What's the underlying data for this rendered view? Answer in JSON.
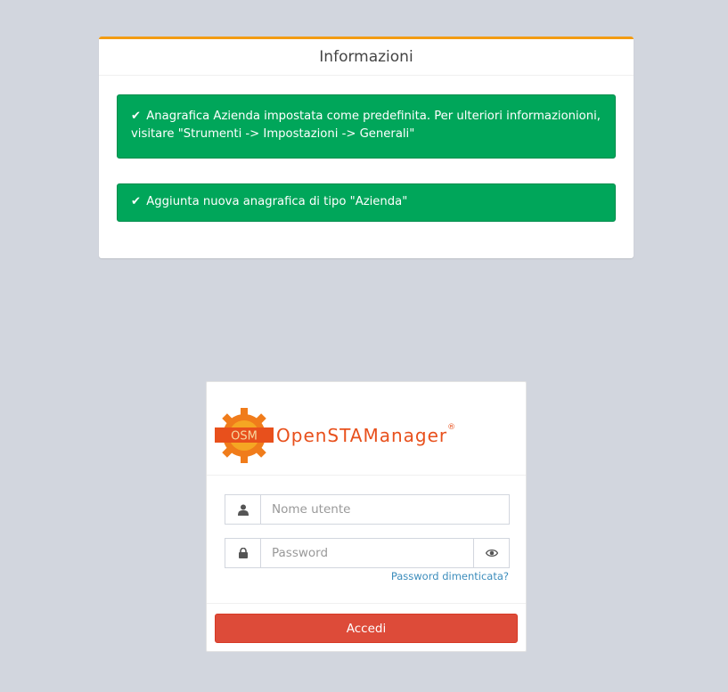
{
  "info_box": {
    "title": "Informazioni",
    "alerts": [
      {
        "icon": "check-icon",
        "text": "Anagrafica Azienda impostata come predefinita. Per ulteriori informazionioni, visitare \"Strumenti -> Impostazioni -> Generali\""
      },
      {
        "icon": "check-icon",
        "text": "Aggiunta nuova anagrafica di tipo \"Azienda\""
      }
    ]
  },
  "login": {
    "logo_badge": "OSM",
    "logo_text": "OpenSTAManager",
    "logo_registered": "®",
    "username_placeholder": "Nome utente",
    "password_placeholder": "Password",
    "forgot_label": "Password dimenticata?",
    "submit_label": "Accedi"
  },
  "colors": {
    "background": "#d2d6de",
    "warning_accent": "#f39c12",
    "success": "#00a65a",
    "danger": "#dd4b39",
    "link": "#3c8dbc",
    "brand_orange": "#e8501c"
  }
}
